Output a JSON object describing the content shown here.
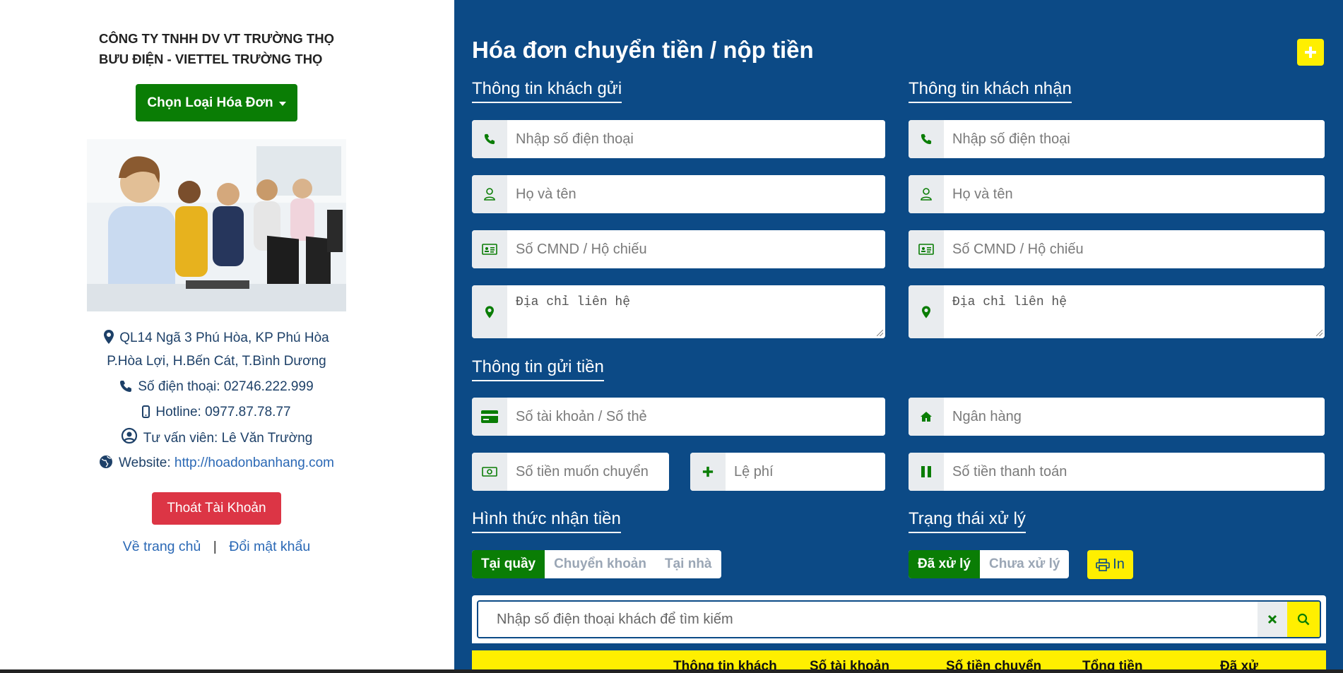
{
  "company": {
    "line1": "CÔNG TY TNHH DV VT TRƯỜNG THỌ",
    "line2": "BƯU ĐIỆN - VIETTEL TRƯỜNG THỌ"
  },
  "menu_button": "Chọn Loại Hóa Đơn",
  "contact": {
    "address_line1": "QL14 Ngã 3 Phú Hòa, KP Phú Hòa",
    "address_line2": "P.Hòa Lợi, H.Bến Cát, T.Bình Dương",
    "phone": "Số điện thoại: 02746.222.999",
    "hotline": "Hotline: 0977.87.78.77",
    "advisor": "Tư vấn viên: Lê Văn Trường",
    "website_label": "Website:",
    "website_url": "http://hoadonbanhang.com"
  },
  "logout_button": "Thoát Tài Khoản",
  "links": {
    "home": "Về trang chủ",
    "separator": "|",
    "change_password": "Đổi mật khẩu"
  },
  "form": {
    "title": "Hóa đơn chuyển tiền / nộp tiền",
    "sender_heading": "Thông tin khách gửi",
    "receiver_heading": "Thông tin khách nhận",
    "phone_placeholder": "Nhập số điện thoại",
    "name_placeholder": "Họ và tên",
    "id_placeholder": "Số CMND / Hộ chiếu",
    "address_placeholder": "Địa chỉ liên hệ",
    "transfer_heading": "Thông tin gửi tiền",
    "account_placeholder": "Số tài khoản / Số thẻ",
    "bank_placeholder": "Ngân hàng",
    "amount_placeholder": "Số tiền muốn chuyển",
    "fee_placeholder": "Lệ phí",
    "total_placeholder": "Số tiền thanh toán",
    "receive_method_heading": "Hình thức nhận tiền",
    "receive_methods": [
      "Tại quầy",
      "Chuyển khoản",
      "Tại nhà"
    ],
    "receive_selected": "Tại quầy",
    "status_heading": "Trạng thái xử lý",
    "status_options": [
      "Đã xử lý",
      "Chưa xử lý"
    ],
    "status_selected": "Đã xử lý",
    "print_button": "In",
    "search_placeholder": "Nhập số điện thoại khách để tìm kiếm"
  },
  "table": {
    "headers": [
      "Thông tin khách",
      "Số tài khoản",
      "Số tiền chuyển",
      "Tổng tiền",
      "Đã xử"
    ]
  },
  "colors": {
    "panel_blue": "#0c4a86",
    "accent_yellow": "#ffef00",
    "green": "#0a7d05",
    "red": "#dc3545"
  }
}
